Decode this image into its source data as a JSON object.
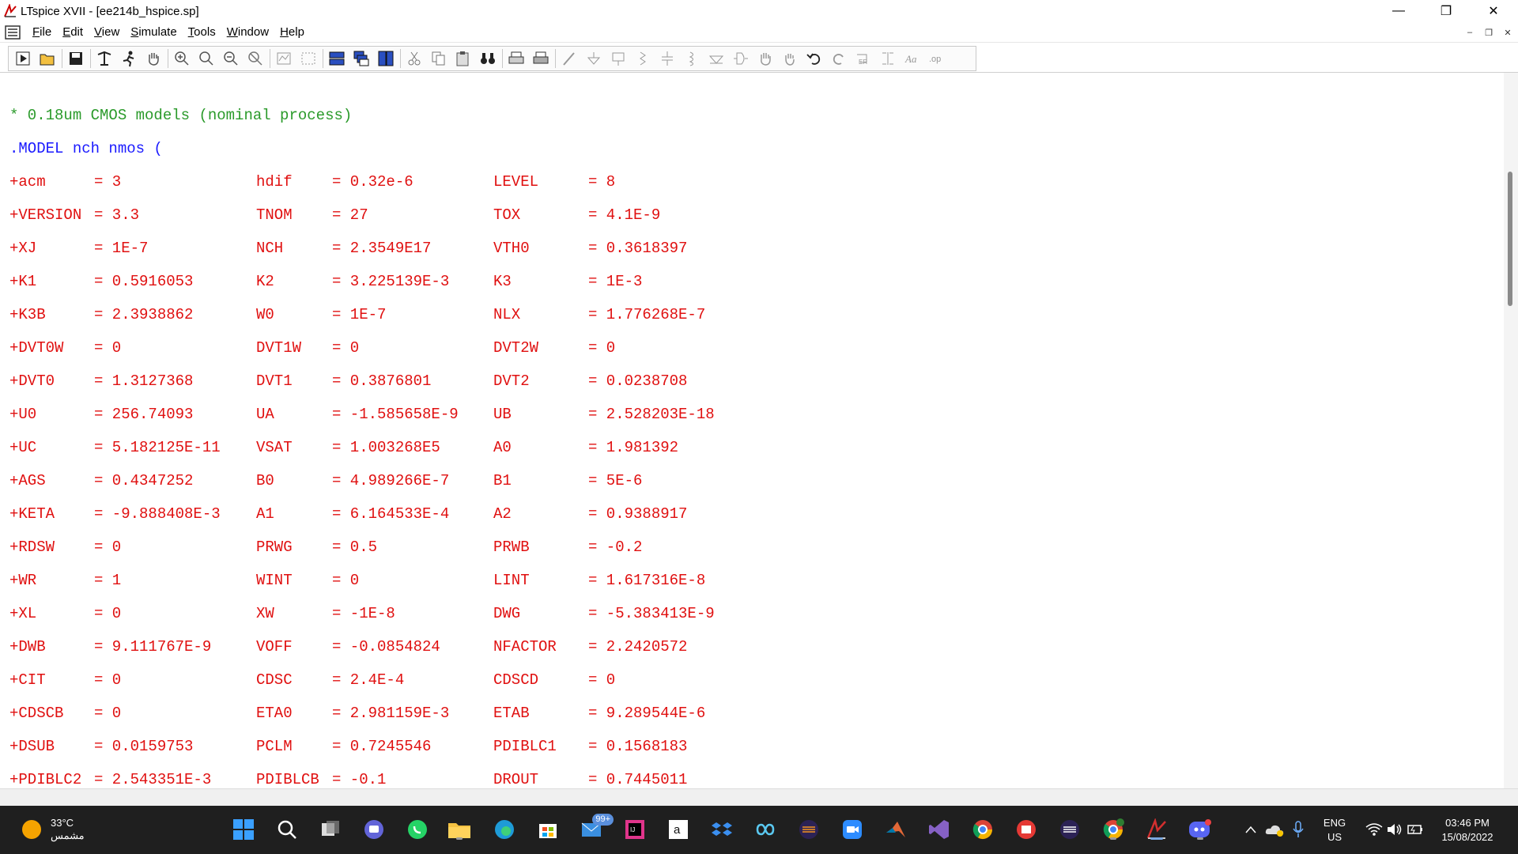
{
  "window": {
    "title": "LTspice XVII - [ee214b_hspice.sp]",
    "minimize": "—",
    "restore": "❐",
    "close": "✕"
  },
  "menu": [
    "File",
    "Edit",
    "View",
    "Simulate",
    "Tools",
    "Window",
    "Help"
  ],
  "mdi": {
    "minimize": "–",
    "restore": "❐",
    "close": "✕"
  },
  "editor": {
    "comment": "* 0.18um CMOS models (nominal process)",
    "model_line": ".MODEL nch nmos (",
    "rows": [
      [
        "+acm",
        "= 3",
        "hdif",
        "= 0.32e-6",
        "LEVEL",
        "= 8"
      ],
      [
        "+VERSION",
        "= 3.3",
        "TNOM",
        "= 27",
        "TOX",
        "= 4.1E-9"
      ],
      [
        "+XJ",
        "= 1E-7",
        "NCH",
        "= 2.3549E17",
        "VTH0",
        "= 0.3618397"
      ],
      [
        "+K1",
        "= 0.5916053",
        "K2",
        "= 3.225139E-3",
        "K3",
        "= 1E-3"
      ],
      [
        "+K3B",
        "= 2.3938862",
        "W0",
        "= 1E-7",
        "NLX",
        "= 1.776268E-7"
      ],
      [
        "+DVT0W",
        "= 0",
        "DVT1W",
        "= 0",
        "DVT2W",
        "= 0"
      ],
      [
        "+DVT0",
        "= 1.3127368",
        "DVT1",
        "= 0.3876801",
        "DVT2",
        "= 0.0238708"
      ],
      [
        "+U0",
        "= 256.74093",
        "UA",
        "= -1.585658E-9",
        "UB",
        "= 2.528203E-18"
      ],
      [
        "+UC",
        "= 5.182125E-11",
        "VSAT",
        "= 1.003268E5",
        "A0",
        "= 1.981392"
      ],
      [
        "+AGS",
        "= 0.4347252",
        "B0",
        "= 4.989266E-7",
        "B1",
        "= 5E-6"
      ],
      [
        "+KETA",
        "= -9.888408E-3",
        "A1",
        "= 6.164533E-4",
        "A2",
        "= 0.9388917"
      ],
      [
        "+RDSW",
        "= 0",
        "PRWG",
        "= 0.5",
        "PRWB",
        "= -0.2"
      ],
      [
        "+WR",
        "= 1",
        "WINT",
        "= 0",
        "LINT",
        "= 1.617316E-8"
      ],
      [
        "+XL",
        "= 0",
        "XW",
        "= -1E-8",
        "DWG",
        "= -5.383413E-9"
      ],
      [
        "+DWB",
        "= 9.111767E-9",
        "VOFF",
        "= -0.0854824",
        "NFACTOR",
        "= 2.2420572"
      ],
      [
        "+CIT",
        "= 0",
        "CDSC",
        "= 2.4E-4",
        "CDSCD",
        "= 0"
      ],
      [
        "+CDSCB",
        "= 0",
        "ETA0",
        "= 2.981159E-3",
        "ETAB",
        "= 9.289544E-6"
      ],
      [
        "+DSUB",
        "= 0.0159753",
        "PCLM",
        "= 0.7245546",
        "PDIBLC1",
        "= 0.1568183"
      ],
      [
        "+PDIBLC2",
        "= 2.543351E-3",
        "PDIBLCB",
        "= -0.1",
        "DROUT",
        "= 0.7445011"
      ]
    ]
  },
  "taskbar": {
    "temperature": "33°C",
    "weather_desc": "مشمس",
    "mail_badge": "99+",
    "lang_top": "ENG",
    "lang_bottom": "US",
    "time": "03:46 PM",
    "date": "15/08/2022"
  },
  "colors": {
    "comment": "#2a9a2a",
    "model": "#1a1aff",
    "param": "#e01010"
  }
}
